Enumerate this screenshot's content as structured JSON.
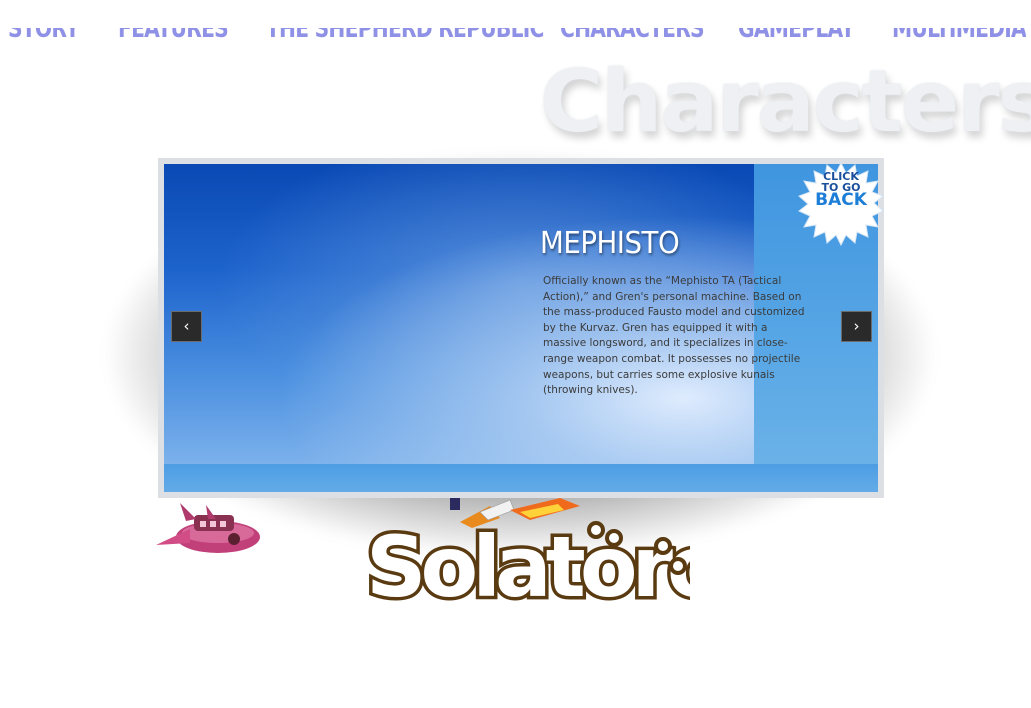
{
  "nav": {
    "items": [
      {
        "label": "Story"
      },
      {
        "label": "Features"
      },
      {
        "label": "The Shepherd Republic"
      },
      {
        "label": "Characters"
      },
      {
        "label": "Gameplay"
      },
      {
        "label": "Multimedia"
      }
    ]
  },
  "page": {
    "heading": "Characters"
  },
  "character": {
    "name": "MEPHISTO",
    "description": "Officially known as the “Mephisto TA (Tactical Action),” and Gren's personal machine. Based on the mass-produced Fausto model and customized by the Kurvaz. Gren has equipped it with a massive longsword, and it specializes in close-range weapon combat. It possesses no projectile weapons, but carries some explosive kunais (throwing knives)."
  },
  "slider": {
    "prev_icon": "chevron-left-icon",
    "next_icon": "chevron-right-icon",
    "prev_glyph": "‹",
    "next_glyph": "›"
  },
  "back_badge": {
    "line1": "CLICK",
    "line2": "TO GO",
    "line3": "BACK"
  },
  "logo": {
    "text": "Solatorobo"
  },
  "colors": {
    "nav": "#8f91e6",
    "badge_text_dark": "#1a4f9c",
    "badge_text_blue": "#1d7ed8",
    "logo_brown": "#5a3a10"
  }
}
